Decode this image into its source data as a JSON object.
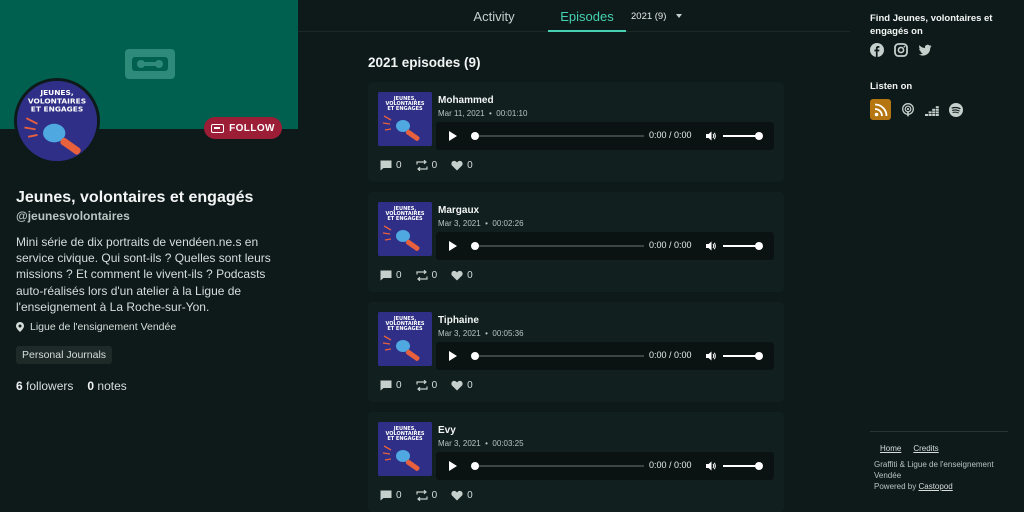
{
  "profile": {
    "title": "Jeunes, volontaires et engagés",
    "handle": "@jeunesvolontaires",
    "description": "Mini série de dix portraits de vendéen.ne.s en service civique. Qui sont-ils ? Quelles sont leurs missions ? Et comment le vivent-ils ? Podcasts auto-réalisés lors d'un atelier à la Ligue de l'enseignement à La Roche-sur-Yon.",
    "location": "Ligue de l'ensignement Vendée",
    "category": "Personal Journals",
    "followers_count": "6",
    "followers_label": "followers",
    "notes_count": "0",
    "notes_label": "notes",
    "follow_label": "FOLLOW",
    "cover_text_line1": "JEUNES,",
    "cover_text_line2": "VOLONTAIRES",
    "cover_text_line3": "ET ENGAGES"
  },
  "nav": {
    "tabs": [
      {
        "label": "Activity",
        "active": false
      },
      {
        "label": "Episodes",
        "active": true
      }
    ],
    "year_select": "2021 (9)"
  },
  "episodes_section": {
    "title": "2021 episodes (9)"
  },
  "episodes": [
    {
      "title": "Mohammed",
      "date": "Mar 11, 2021",
      "duration": "00:01:10",
      "time": "0:00 / 0:00",
      "comments": "0",
      "shares": "0",
      "likes": "0"
    },
    {
      "title": "Margaux",
      "date": "Mar 3, 2021",
      "duration": "00:02:26",
      "time": "0:00 / 0:00",
      "comments": "0",
      "shares": "0",
      "likes": "0"
    },
    {
      "title": "Tiphaine",
      "date": "Mar 3, 2021",
      "duration": "00:05:36",
      "time": "0:00 / 0:00",
      "comments": "0",
      "shares": "0",
      "likes": "0"
    },
    {
      "title": "Evy",
      "date": "Mar 3, 2021",
      "duration": "00:03:25",
      "time": "0:00 / 0:00",
      "comments": "0",
      "shares": "0",
      "likes": "0"
    }
  ],
  "meta_separator": "•",
  "right": {
    "find_title": "Find Jeunes, volontaires et engagés on",
    "social_icons": [
      "facebook-icon",
      "instagram-icon",
      "twitter-icon"
    ],
    "listen_title": "Listen on",
    "listen_icons": [
      "rss-icon",
      "podcast-icon",
      "deezer-icon",
      "spotify-icon"
    ],
    "footer_links": [
      "Home",
      "Credits"
    ],
    "footer_line1": "Graffiti & Ligue de l'enseignement Vendée",
    "footer_powered": "Powered by",
    "footer_castopod": "Castopod"
  },
  "colors": {
    "banner": "#00604f",
    "accent": "#45d1b2",
    "follow": "#9c1d36",
    "rss": "#b57612",
    "cover": "#2f2f87"
  }
}
